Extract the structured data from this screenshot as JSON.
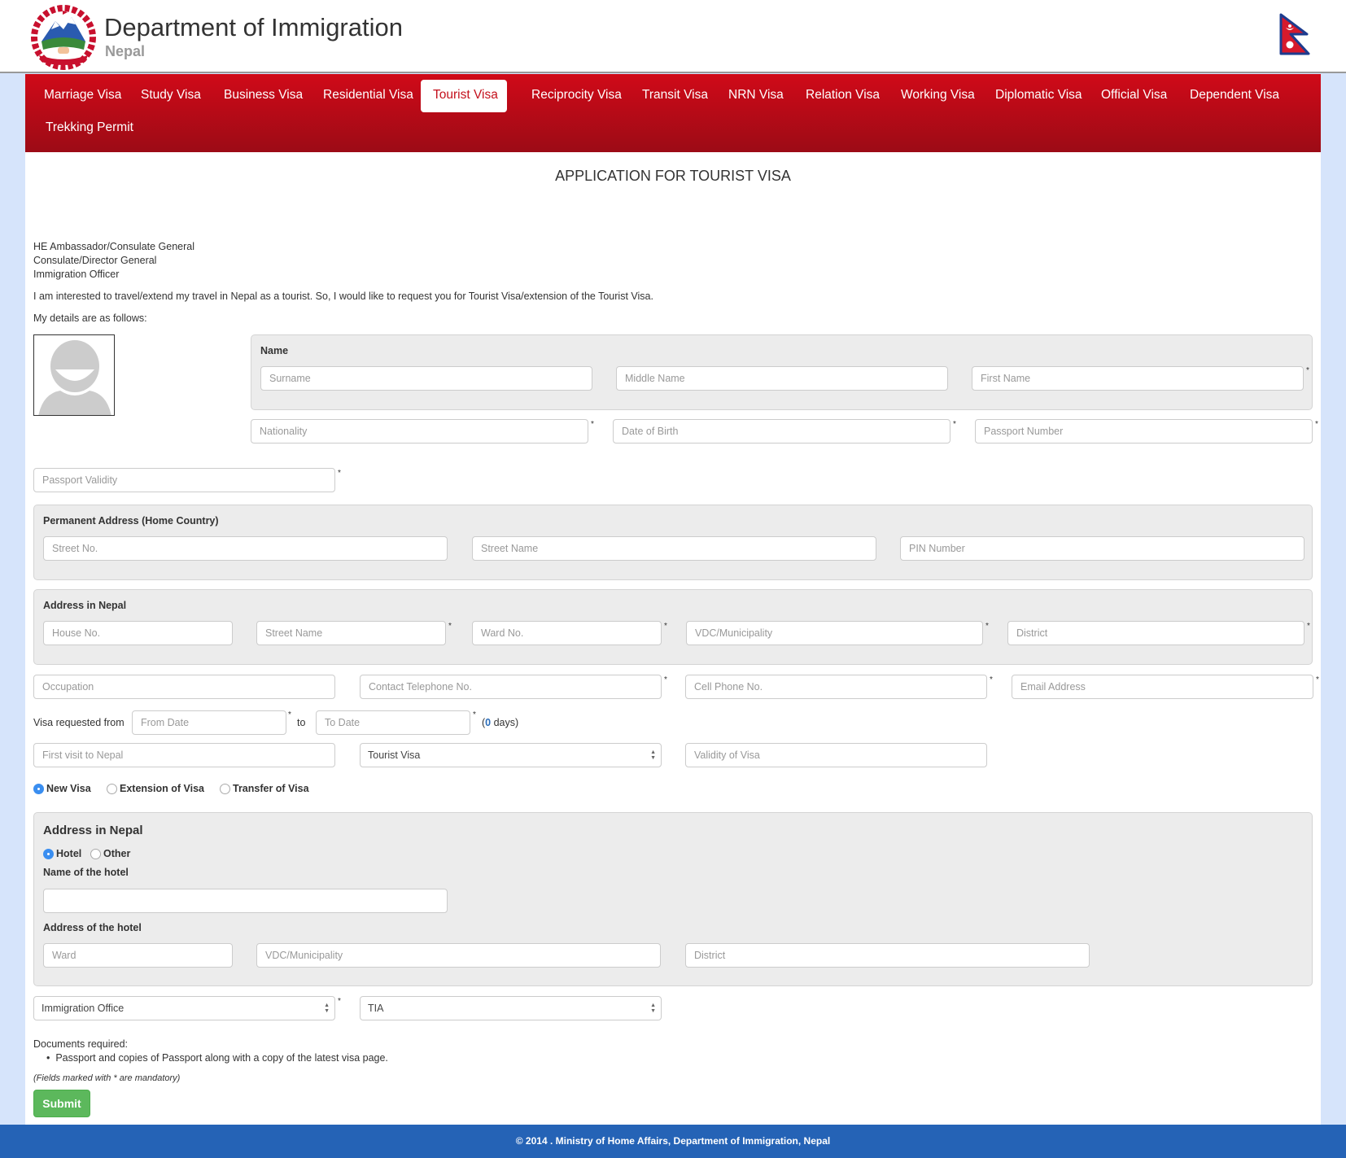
{
  "header": {
    "title": "Department of Immigration",
    "subtitle": "Nepal"
  },
  "nav": {
    "items": [
      {
        "label": "Marriage Visa"
      },
      {
        "label": "Study Visa"
      },
      {
        "label": "Business Visa"
      },
      {
        "label": "Residential Visa"
      },
      {
        "label": "Tourist Visa",
        "active": true
      },
      {
        "label": "Reciprocity Visa"
      },
      {
        "label": "Transit Visa"
      },
      {
        "label": "NRN Visa"
      },
      {
        "label": "Relation Visa"
      },
      {
        "label": "Working Visa"
      },
      {
        "label": "Diplomatic Visa"
      },
      {
        "label": "Official Visa"
      },
      {
        "label": "Dependent Visa"
      },
      {
        "label": "Trekking Permit"
      }
    ]
  },
  "page": {
    "title": "APPLICATION FOR TOURIST VISA",
    "addressee": [
      "HE Ambassador/Consulate General",
      "Consulate/Director General",
      "Immigration Officer"
    ],
    "intro": "I am interested to travel/extend my travel in Nepal as a tourist. So, I would like to request you for Tourist Visa/extension of the Tourist Visa.",
    "details_label": "My details are as follows:"
  },
  "form": {
    "name_section": {
      "label": "Name",
      "surname": "Surname",
      "middle_name": "Middle Name",
      "first_name": "First Name"
    },
    "nationality": "Nationality",
    "dob": "Date of Birth",
    "passport_number": "Passport Number",
    "passport_validity": "Passport Validity",
    "permanent_address": {
      "label": "Permanent Address (Home Country)",
      "street_no": "Street No.",
      "street_name": "Street Name",
      "pin": "PIN Number"
    },
    "nepal_address": {
      "label": "Address in Nepal",
      "house_no": "House No.",
      "street_name": "Street Name",
      "ward_no": "Ward No.",
      "vdc": "VDC/Municipality",
      "district": "District"
    },
    "occupation": "Occupation",
    "contact_tel": "Contact Telephone No.",
    "cell_phone": "Cell Phone No.",
    "email": "Email Address",
    "visa_from_label": "Visa requested from",
    "from_date": "From Date",
    "to_label": "to",
    "to_date": "To Date",
    "days_prefix": "(",
    "days_count": "0",
    "days_suffix": " days)",
    "first_visit": "First visit to Nepal",
    "visa_type_selected": "Tourist Visa",
    "validity_of_visa": "Validity of Visa",
    "visa_kind": [
      {
        "label": "New Visa",
        "checked": true
      },
      {
        "label": "Extension of Visa",
        "checked": false
      },
      {
        "label": "Transfer of Visa",
        "checked": false
      }
    ],
    "stay": {
      "label": "Address in Nepal",
      "options": [
        {
          "label": "Hotel",
          "checked": true
        },
        {
          "label": "Other",
          "checked": false
        }
      ],
      "hotel_name_label": "Name of the hotel",
      "hotel_name_value": "",
      "hotel_address_label": "Address of the hotel",
      "ward": "Ward",
      "vdc": "VDC/Municipality",
      "district": "District"
    },
    "office_select": "Immigration Office",
    "location_select": "TIA",
    "documents_label": "Documents required:",
    "documents": [
      "Passport and copies of Passport along with a copy of the latest visa page."
    ],
    "mandatory_note": "(Fields marked with * are mandatory)",
    "submit_label": "Submit",
    "required_mark": "*"
  },
  "footer": {
    "text": "© 2014 . Ministry of Home Affairs, Department of Immigration, Nepal"
  },
  "colors": {
    "nav_top": "#d00a18",
    "nav_bottom": "#9c0b16",
    "submit": "#5cb85c",
    "footer": "#2563b6",
    "radio_checked": "#3a8ef0"
  }
}
